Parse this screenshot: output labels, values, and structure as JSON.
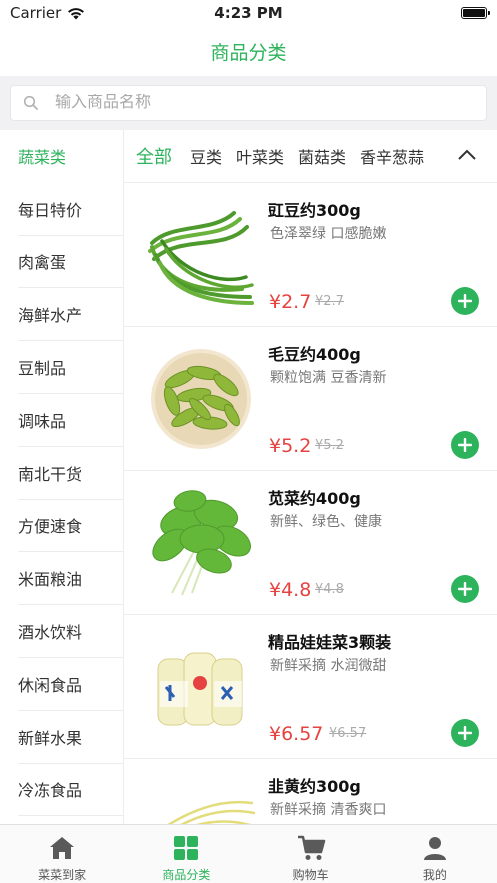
{
  "status_bar": {
    "carrier": "Carrier",
    "time": "4:23 PM"
  },
  "nav": {
    "title": "商品分类"
  },
  "search": {
    "placeholder": "输入商品名称"
  },
  "sidebar": {
    "items": [
      {
        "label": "蔬菜类",
        "active": true
      },
      {
        "label": "每日特价"
      },
      {
        "label": "肉禽蛋"
      },
      {
        "label": "海鲜水产"
      },
      {
        "label": "豆制品"
      },
      {
        "label": "调味品"
      },
      {
        "label": "南北干货"
      },
      {
        "label": "方便速食"
      },
      {
        "label": "米面粮油"
      },
      {
        "label": "酒水饮料"
      },
      {
        "label": "休闲食品"
      },
      {
        "label": "新鲜水果"
      },
      {
        "label": "冷冻食品"
      }
    ]
  },
  "sub_tabs": {
    "items": [
      "全部",
      "豆类",
      "叶菜类",
      "菌菇类",
      "香辛葱蒜"
    ]
  },
  "products": [
    {
      "name": "豇豆约300g",
      "desc": "色泽翠绿 口感脆嫩",
      "price": "¥2.7",
      "old_price": "¥2.7"
    },
    {
      "name": "毛豆约400g",
      "desc": "颗粒饱满 豆香清新",
      "price": "¥5.2",
      "old_price": "¥5.2"
    },
    {
      "name": "苋菜约400g",
      "desc": "新鲜、绿色、健康",
      "price": "¥4.8",
      "old_price": "¥4.8"
    },
    {
      "name": "精品娃娃菜3颗装",
      "desc": "新鲜采摘 水润微甜",
      "price": "¥6.57",
      "old_price": "¥6.57"
    },
    {
      "name": "韭黄约300g",
      "desc": "新鲜采摘 清香爽口",
      "price": "",
      "old_price": ""
    }
  ],
  "tabbar": {
    "items": [
      {
        "label": "菜菜到家",
        "icon": "home-icon"
      },
      {
        "label": "商品分类",
        "icon": "grid-icon",
        "active": true
      },
      {
        "label": "购物车",
        "icon": "cart-icon"
      },
      {
        "label": "我的",
        "icon": "user-icon"
      }
    ]
  },
  "colors": {
    "accent": "#2db35c",
    "price": "#e64340"
  }
}
